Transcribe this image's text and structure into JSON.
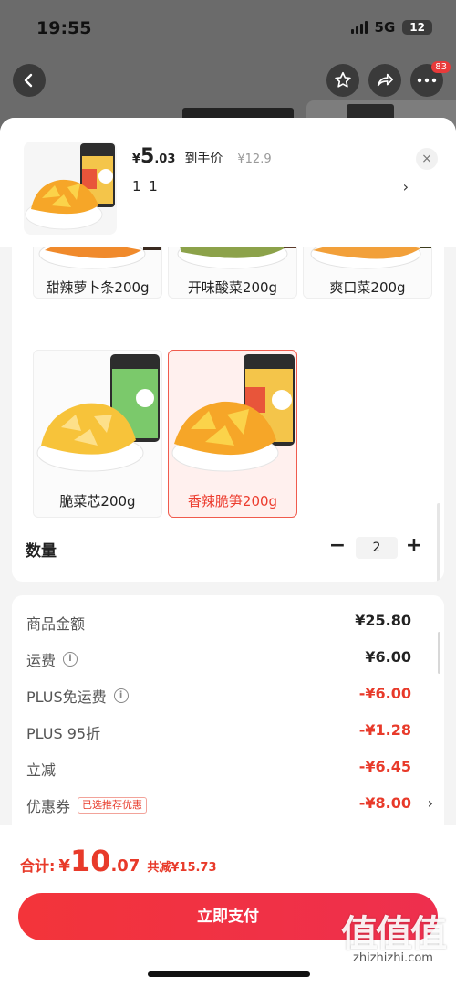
{
  "status_bar": {
    "time": "19:55",
    "network": "5G",
    "battery": "12"
  },
  "nav": {
    "more_badge": "83"
  },
  "sheet_header": {
    "price_currency": "¥",
    "price_int": "5",
    "price_dec": ".03",
    "price_note": "到手价",
    "original_price": "¥12.9",
    "selected_spec": "1 1",
    "chevron": "›",
    "close": "×"
  },
  "options": [
    {
      "label": "甜辣萝卜条200g",
      "selected": false,
      "food_color": "#f08a2c"
    },
    {
      "label": "开味酸菜200g",
      "selected": false,
      "food_color": "#8ca24a"
    },
    {
      "label": "爽口菜200g",
      "selected": false,
      "food_color": "#f2a03a"
    },
    {
      "label": "脆菜芯200g",
      "selected": false,
      "food_color": "#f7c33a"
    },
    {
      "label": "香辣脆笋200g",
      "selected": true,
      "food_color": "#f6a628"
    }
  ],
  "quantity": {
    "label": "数量",
    "minus": "−",
    "value": "2",
    "plus": "+"
  },
  "summary": {
    "rows": [
      {
        "label": "商品金额",
        "value": "¥25.80"
      },
      {
        "label": "运费",
        "value": "¥6.00"
      },
      {
        "label": "PLUS免运费",
        "value": "-¥6.00"
      },
      {
        "label": "PLUS 95折",
        "value": "-¥1.28"
      },
      {
        "label": "立减",
        "value": "-¥6.45"
      },
      {
        "label": "优惠券",
        "value": "-¥8.00"
      }
    ],
    "coupon_tag": "已选推荐优惠",
    "info_glyph": "i"
  },
  "bottom": {
    "total_label": "合计:",
    "total_currency": "¥",
    "total_int": "10",
    "total_dec": ".07",
    "saved": "共减¥15.73",
    "pay_button": "立即支付"
  },
  "watermark": {
    "logo": "值值值",
    "url": "zhizhizhi.com"
  },
  "colors": {
    "accent": "#e83a2a",
    "pay_button": "#f3343a",
    "selected_border": "#f05b4d"
  }
}
